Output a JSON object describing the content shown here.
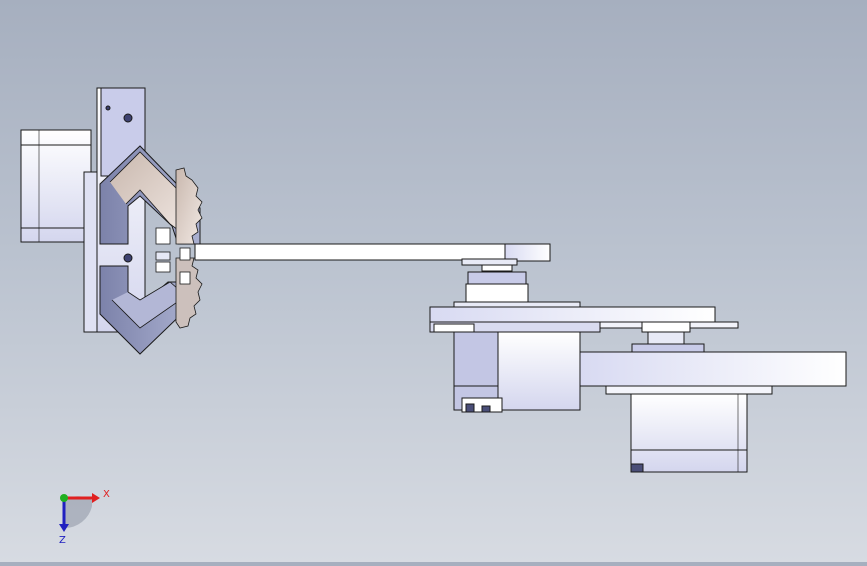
{
  "viewport": {
    "background_top": "#a6afbf",
    "background_bottom": "#d7dbe2",
    "part_face_color": "#ffffff",
    "part_shade_color": "#c8cbe8",
    "part_dark_color": "#8a8fb4",
    "edge_color": "#1a1a1a",
    "gear_color": "#e5d8d0"
  },
  "triad": {
    "x_label": "X",
    "z_label": "Z",
    "x_color": "#e02020",
    "y_color": "#20b020",
    "z_color": "#2020c0"
  }
}
